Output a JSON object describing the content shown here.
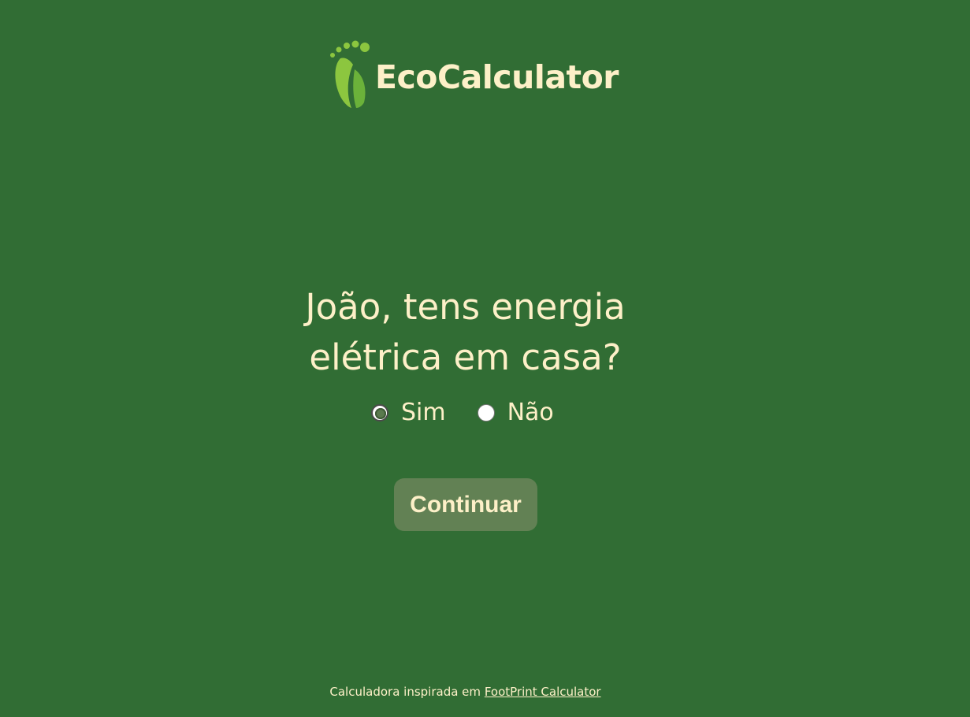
{
  "brand": {
    "name": "EcoCalculator",
    "logo_icon": "footprint-leaf-icon",
    "logo_colors": [
      "#8cc63f",
      "#6bb23a"
    ]
  },
  "question": {
    "line1": "João, tens energia",
    "line2": "elétrica em casa?"
  },
  "options": [
    {
      "label": "Sim",
      "selected": true
    },
    {
      "label": "Não",
      "selected": false
    }
  ],
  "continue_button": {
    "label": "Continuar"
  },
  "footer": {
    "text": "Calculadora inspirada em",
    "link_text": "FootPrint Calculator"
  },
  "colors": {
    "background": "#316d34",
    "text": "#fdf0c8",
    "button": "#628154"
  }
}
